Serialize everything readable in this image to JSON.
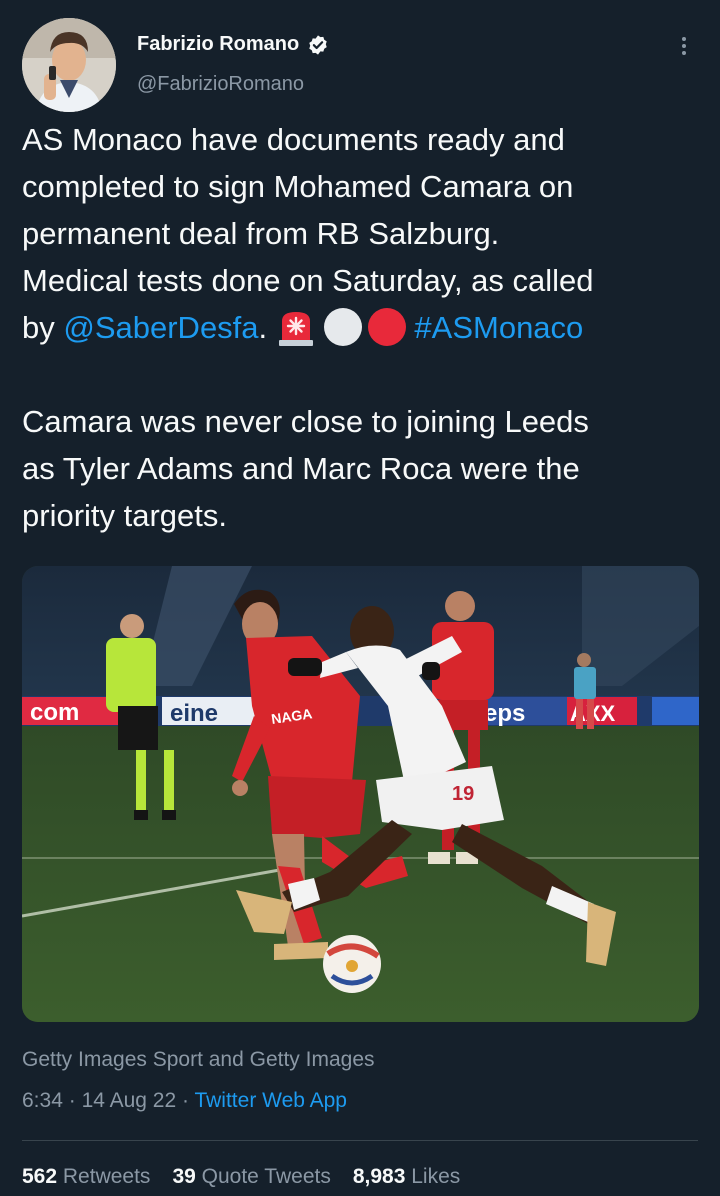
{
  "tweet": {
    "author_name": "Fabrizio Romano",
    "author_handle": "@FabrizioRomano",
    "verified_icon": "verified-badge-icon",
    "more_icon": "more-options-icon",
    "text": {
      "line1": "AS Monaco have documents ready and",
      "line2": "completed to sign Mohamed Camara on",
      "line3": "permanent deal from RB Salzburg.",
      "line4": "Medical tests done on Saturday, as called",
      "line5_prefix": "by ",
      "mention": "@SaberDesfa",
      "line5_after_mention": ". ",
      "hashtag": "#ASMonaco",
      "para2_line1": "Camara was never close to joining Leeds",
      "para2_line2": "as Tyler Adams and Marc Roca were the",
      "para2_line3": "priority targets."
    },
    "emojis": [
      "siren-emoji",
      "white-circle-emoji",
      "red-circle-emoji"
    ],
    "media_credit": "Getty Images Sport and Getty Images",
    "time": "6:34",
    "date": "14 Aug 22",
    "separator": "·",
    "source": "Twitter Web App",
    "stats": {
      "retweets_count": "562",
      "retweets_label": "Retweets",
      "quotes_count": "39",
      "quotes_label": "Quote Tweets",
      "likes_count": "8,983",
      "likes_label": "Likes"
    },
    "colors": {
      "background": "#15202b",
      "text": "#f7f9f9",
      "secondary": "#8b98a5",
      "link": "#1d9bf0"
    }
  },
  "photo": {
    "ad_boards": [
      "com",
      "eine",
      "eps",
      "AXX"
    ],
    "shirt_number": "19",
    "shirt_sponsor": "NAGA"
  }
}
